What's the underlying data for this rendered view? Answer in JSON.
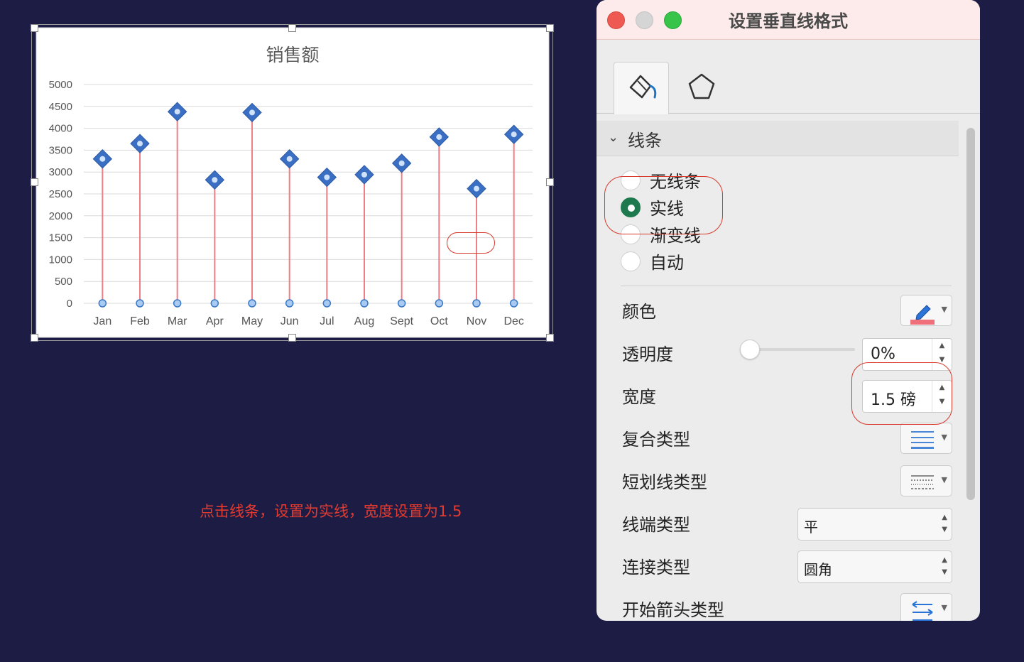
{
  "chart_data": {
    "type": "line",
    "title": "销售额",
    "categories": [
      "Jan",
      "Feb",
      "Mar",
      "Apr",
      "May",
      "Jun",
      "Jul",
      "Aug",
      "Sept",
      "Oct",
      "Nov",
      "Dec"
    ],
    "series": [
      {
        "values": [
          3300,
          3650,
          4380,
          2820,
          4360,
          3300,
          2880,
          2940,
          3200,
          3800,
          2620,
          3860
        ]
      }
    ],
    "baseline_values": [
      0,
      0,
      0,
      0,
      0,
      0,
      0,
      0,
      0,
      0,
      0,
      0
    ],
    "yticks": [
      "0",
      "500",
      "1000",
      "1500",
      "2000",
      "2500",
      "3000",
      "3500",
      "4000",
      "4500",
      "5000"
    ],
    "ylim": [
      0,
      5000
    ],
    "grid": true,
    "line_color": "#ef7e86",
    "marker_color": "#3a6fc4"
  },
  "instruction": "点击线条，设置为实线，宽度设置为1.5",
  "panel": {
    "title": "设置垂直线格式",
    "section": "线条",
    "line_options": [
      {
        "label": "无线条",
        "checked": false
      },
      {
        "label": "实线",
        "checked": true
      },
      {
        "label": "渐变线",
        "checked": false
      },
      {
        "label": "自动",
        "checked": false
      }
    ],
    "color_label": "颜色",
    "color_value": "#ef6f7a",
    "transparency_label": "透明度",
    "transparency_value": "0%",
    "transparency_level": 0,
    "width_label": "宽度",
    "width_value": "1.5 磅",
    "compound_label": "复合类型",
    "dash_label": "短划线类型",
    "cap_label": "线端类型",
    "cap_value": "平",
    "join_label": "连接类型",
    "join_value": "圆角",
    "arrow_label": "开始箭头类型",
    "accent": "#1e7a4e"
  }
}
